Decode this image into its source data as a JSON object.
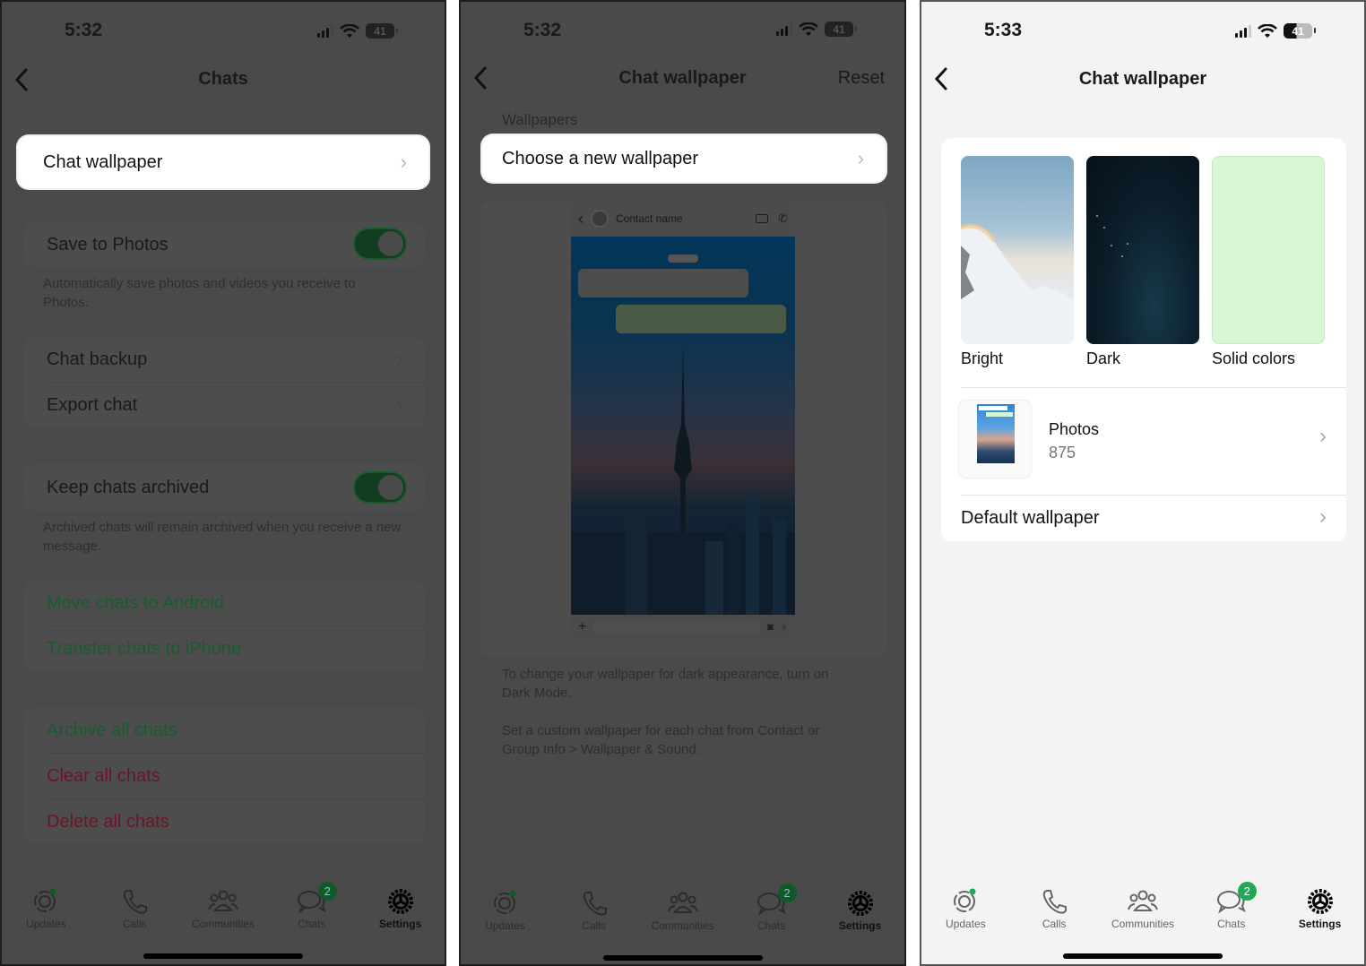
{
  "colors": {
    "whatsapp_green": "#1ea952",
    "dim_overlay": "#4a4a4a",
    "light_bg": "#f3f3f3",
    "destructive_red_dimmed": "#6a1628",
    "action_green_dimmed": "#1a5a30"
  },
  "screens": [
    {
      "status": {
        "time": "5:32",
        "battery": "41"
      },
      "nav": {
        "back_icon": "chevron-left-icon",
        "title": "Chats"
      },
      "highlighted_item": {
        "label": "Chat wallpaper"
      },
      "save_to_photos": {
        "label": "Save to Photos",
        "enabled": true,
        "description": "Automatically save photos and videos you receive to Photos."
      },
      "backup_group": [
        {
          "label": "Chat backup"
        },
        {
          "label": "Export chat"
        }
      ],
      "keep_archived": {
        "label": "Keep chats archived",
        "enabled": true,
        "description": "Archived chats will remain archived when you receive a new message."
      },
      "transfer_group": [
        {
          "label": "Move chats to Android"
        },
        {
          "label": "Transfer chats to iPhone"
        }
      ],
      "danger_group": [
        {
          "label": "Archive all chats"
        },
        {
          "label": "Clear all chats"
        },
        {
          "label": "Delete all chats"
        }
      ]
    },
    {
      "status": {
        "time": "5:32",
        "battery": "41"
      },
      "nav": {
        "back_icon": "chevron-left-icon",
        "title": "Chat wallpaper",
        "right_action": "Reset"
      },
      "section_header": "Wallpapers",
      "highlighted_item": {
        "label": "Choose a new wallpaper"
      },
      "preview": {
        "contact_name": "Contact name"
      },
      "footnote_1": "To change your wallpaper for dark appearance, turn on Dark Mode.",
      "footnote_2": "Set a custom wallpaper for each chat from Contact or Group Info > Wallpaper & Sound."
    },
    {
      "status": {
        "time": "5:33",
        "battery": "41"
      },
      "nav": {
        "back_icon": "chevron-left-icon",
        "title": "Chat wallpaper"
      },
      "categories": [
        {
          "label": "Bright"
        },
        {
          "label": "Dark"
        },
        {
          "label": "Solid colors"
        }
      ],
      "photos": {
        "label": "Photos",
        "count": "875"
      },
      "default_wallpaper": {
        "label": "Default wallpaper"
      }
    }
  ],
  "tabbar": {
    "tabs": [
      {
        "label": "Updates",
        "icon": "updates-icon"
      },
      {
        "label": "Calls",
        "icon": "phone-icon"
      },
      {
        "label": "Communities",
        "icon": "communities-icon"
      },
      {
        "label": "Chats",
        "icon": "chat-bubbles-icon",
        "badge": "2"
      },
      {
        "label": "Settings",
        "icon": "gear-icon",
        "active": true
      }
    ]
  }
}
